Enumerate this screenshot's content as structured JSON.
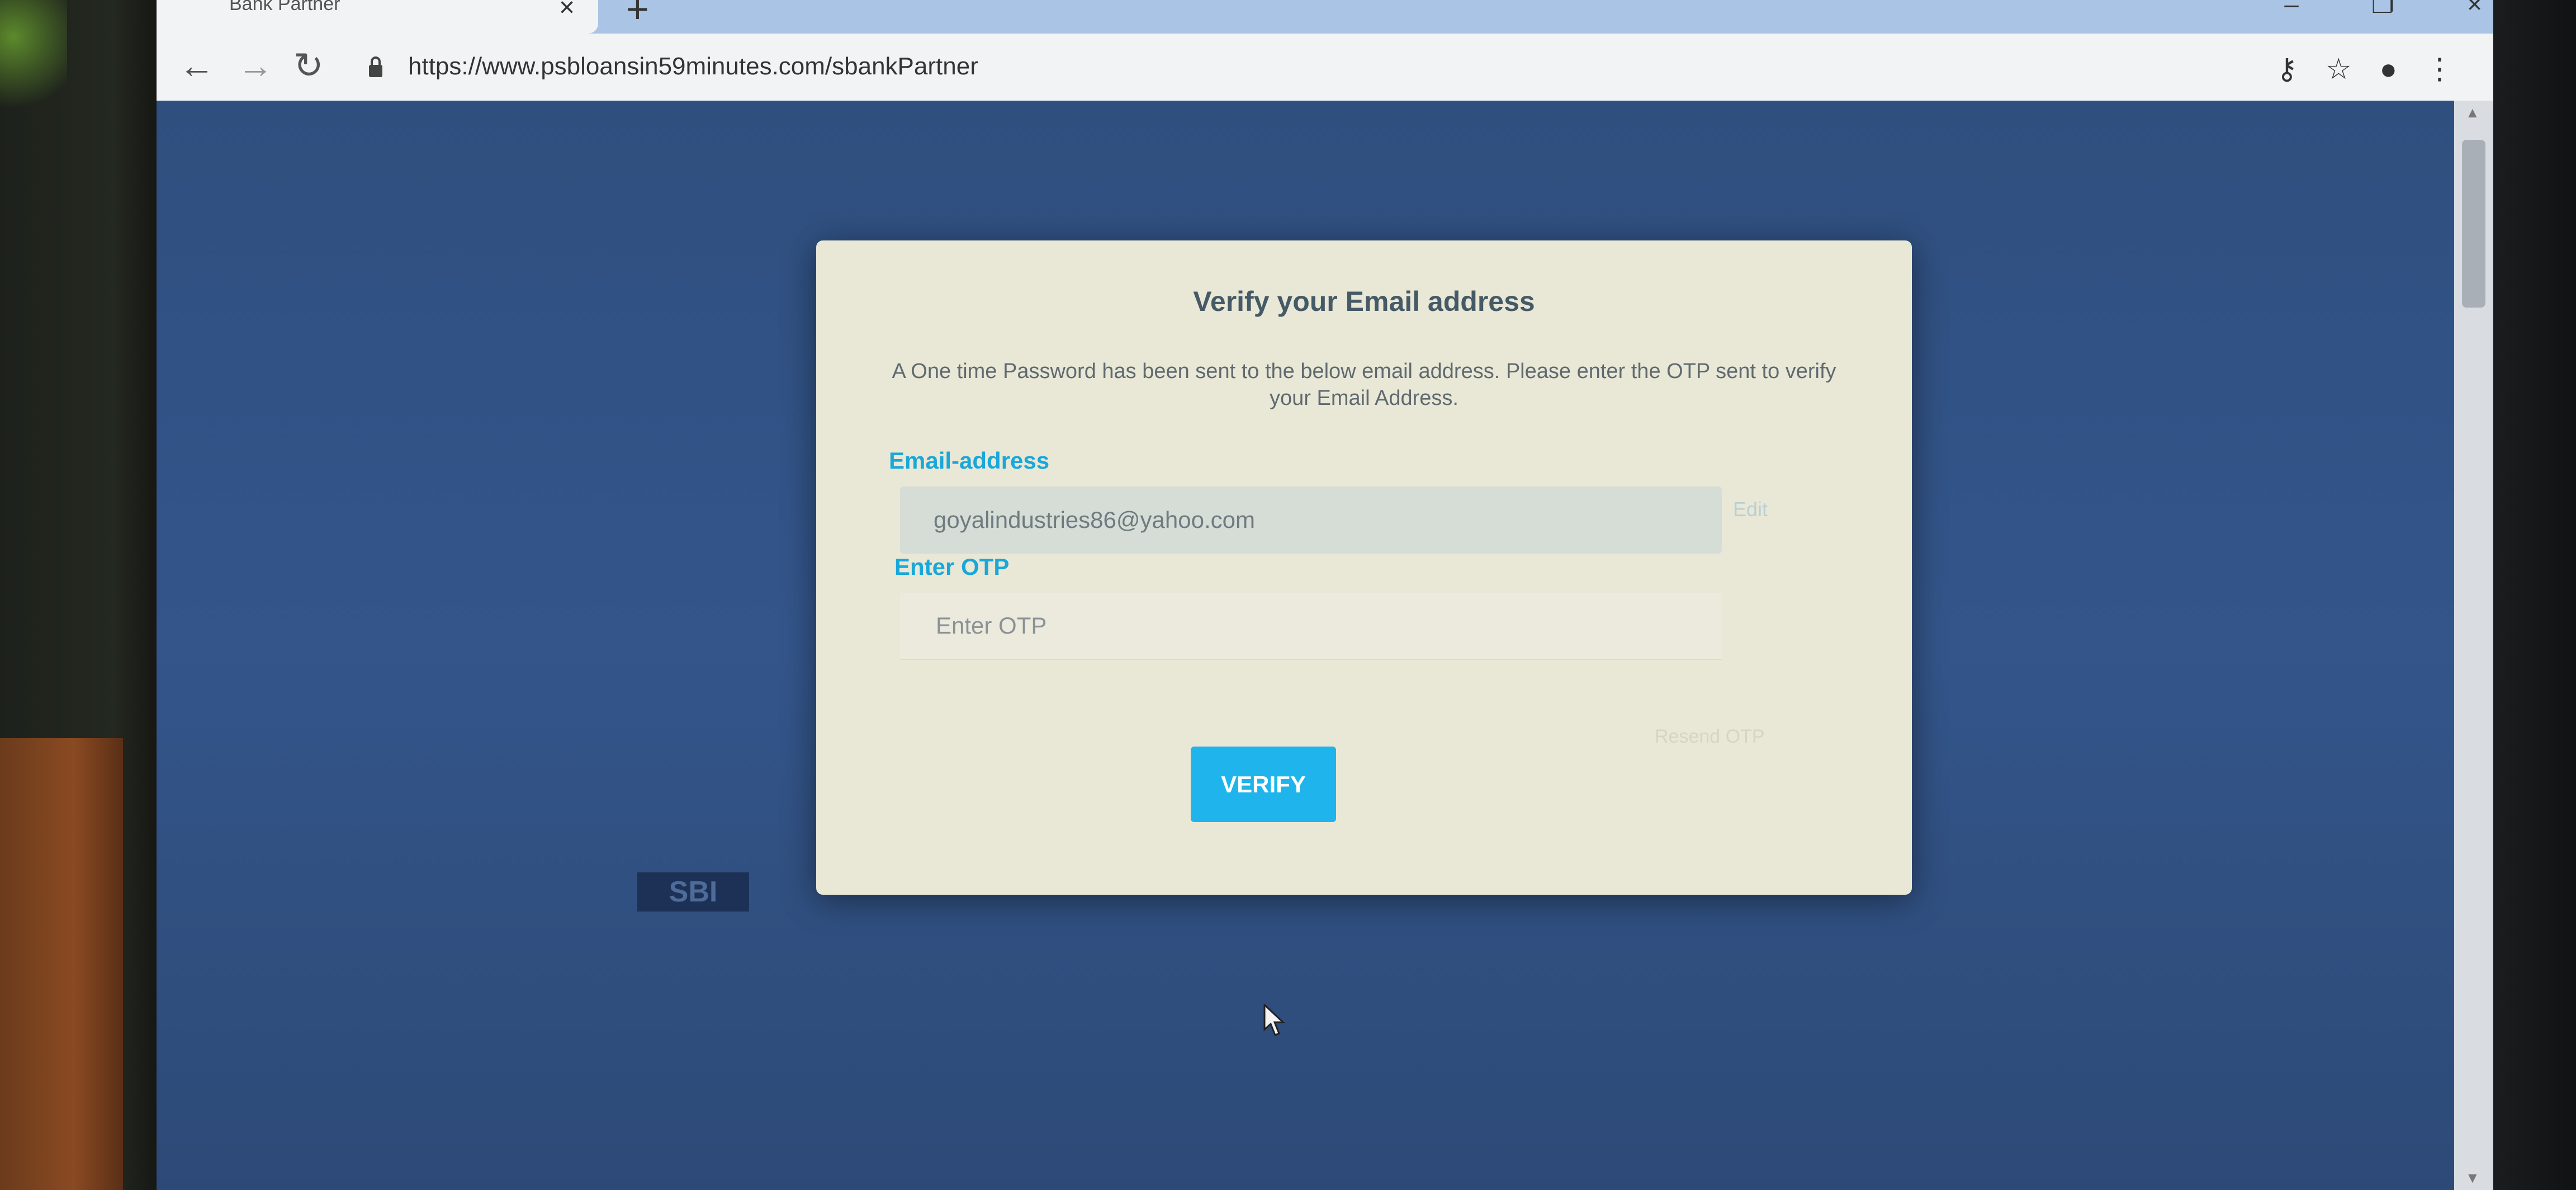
{
  "browser": {
    "tab_title": "Bank Partner",
    "tab_close": "×",
    "new_tab": "+",
    "window_controls": [
      "–",
      "❐",
      "×"
    ],
    "url": "https://www.psbloansin59minutes.com/sbankPartner"
  },
  "modal": {
    "title": "Verify your Email address",
    "description": "A One time Password has been sent to the below email address. Please enter the OTP sent to verify your Email Address.",
    "email_label": "Email-address",
    "email_value": "goyalindustries86@yahoo.com",
    "edit_label": "Edit",
    "otp_label": "Enter OTP",
    "otp_placeholder": "Enter OTP",
    "resend_label": "Resend OTP",
    "verify_label": "VERIFY"
  },
  "background": {
    "badge": "SBI"
  },
  "colors": {
    "accent": "#1aa7d9",
    "button": "#1fb5ec",
    "modal_bg": "#e9e8d6",
    "page_bg": "#2f4f7f"
  },
  "icons": [
    "back-arrow-icon",
    "forward-arrow-icon",
    "reload-icon",
    "lock-icon",
    "key-icon",
    "star-icon",
    "account-icon",
    "menu-icon",
    "mouse-cursor-icon"
  ]
}
